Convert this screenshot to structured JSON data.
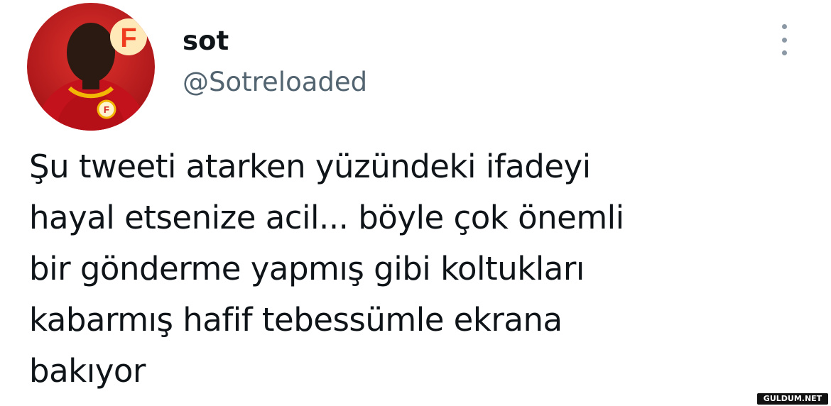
{
  "user": {
    "display_name": "sot",
    "handle": "@Sotreloaded",
    "avatar_icon": "profile-photo"
  },
  "tweet": {
    "lines": [
      "Şu tweeti atarken yüzündeki ifadeyi",
      "hayal etsenize acil... böyle çok önemli",
      "bir gönderme yapmış gibi koltukları",
      "kabarmış hafif tebessümle ekrana",
      "bakıyor"
    ]
  },
  "more_menu": {
    "icon": "more-vertical-icon"
  },
  "watermark": {
    "text": "GULDUM.NET"
  },
  "colors": {
    "text": "#0f1419",
    "secondary": "#536471",
    "avatar_bg": "#c8161e",
    "badge_yellow": "#f6c300"
  }
}
